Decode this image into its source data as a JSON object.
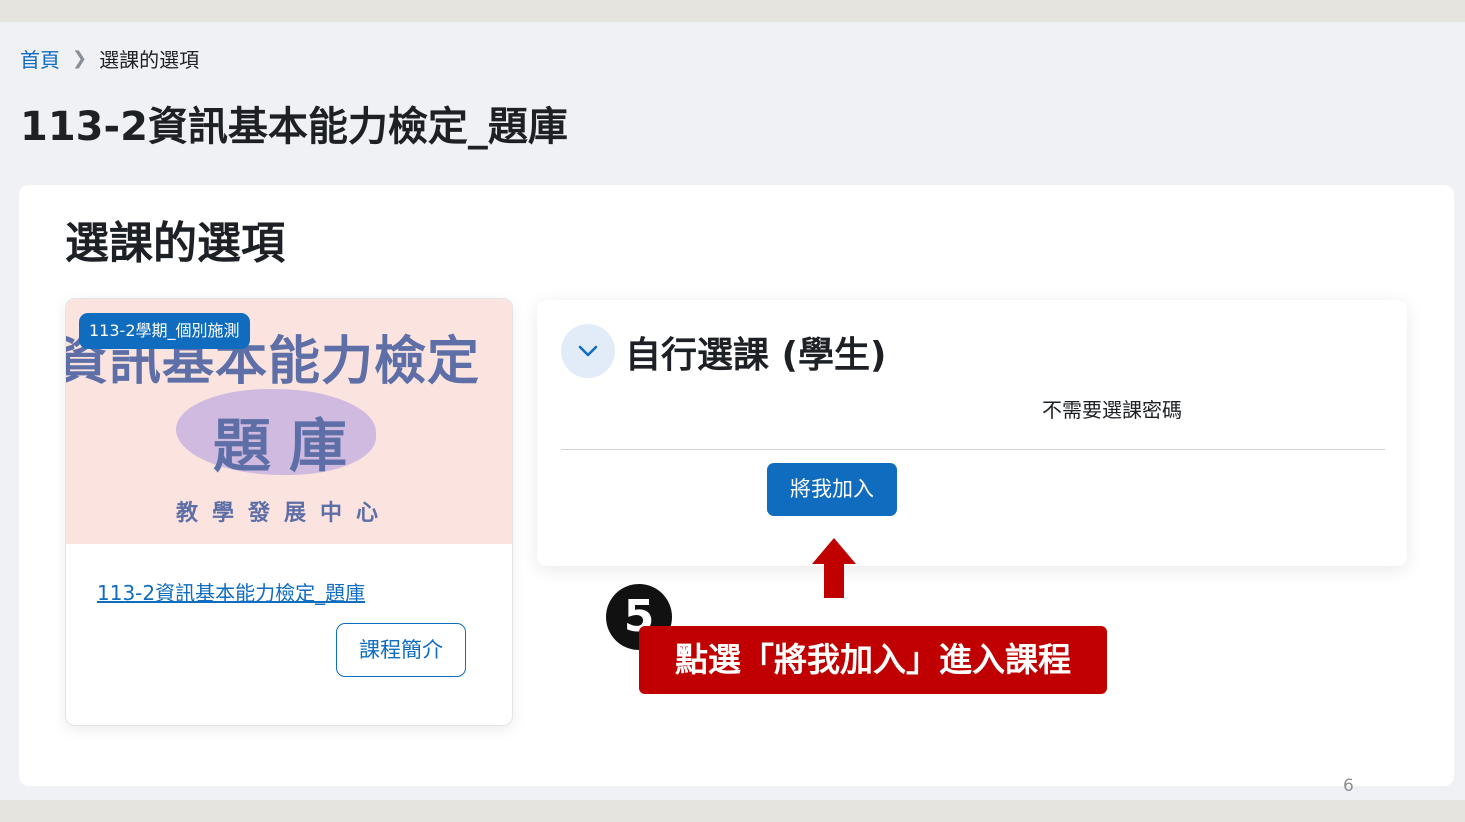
{
  "breadcrumb": {
    "home": "首頁",
    "current": "選課的選項"
  },
  "page_title": "113-2資訊基本能力檢定_題庫",
  "section_title": "選課的選項",
  "course_card": {
    "badge": "113-2學期_個別施測",
    "image_text": {
      "line1": "資訊基本能力檢定",
      "line2": "題庫",
      "line3": "教學發展中心"
    },
    "link": "113-2資訊基本能力檢定_題庫",
    "summary_button": "課程簡介"
  },
  "enrol": {
    "title": "自行選課 (學生)",
    "note": "不需要選課密碼",
    "button": "將我加入"
  },
  "annotation": {
    "step_number": "5",
    "callout_text": "點選「將我加入」進入課程"
  },
  "page_number": "6",
  "colors": {
    "primary": "#0f6cbf",
    "callout": "#c00000",
    "background": "#f0f1f5"
  }
}
